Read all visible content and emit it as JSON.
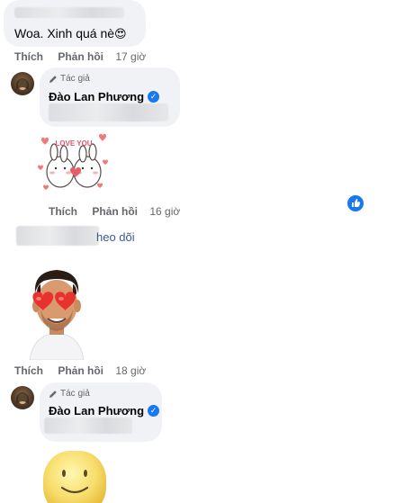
{
  "comment1": {
    "text": "Woa. Xinh quá nè",
    "emoji": "😍",
    "like": "Thích",
    "reply": "Phản hồi",
    "time": "17 giờ"
  },
  "reply1": {
    "author_tag": "Tác giả",
    "author_name": "Đào Lan Phương",
    "sticker_text": "LOVE YOU",
    "like": "Thích",
    "reply": "Phản hồi",
    "time": "16 giờ"
  },
  "comment2": {
    "partial_text": "heo dõi",
    "like": "Thích",
    "reply": "Phản hồi",
    "time": "18 giờ"
  },
  "reply2": {
    "author_tag": "Tác giả",
    "author_name": "Đào Lan Phương"
  },
  "colors": {
    "bubble": "#f0f2f5",
    "link": "#385898",
    "verified": "#1877f2",
    "muted": "#65676b"
  }
}
